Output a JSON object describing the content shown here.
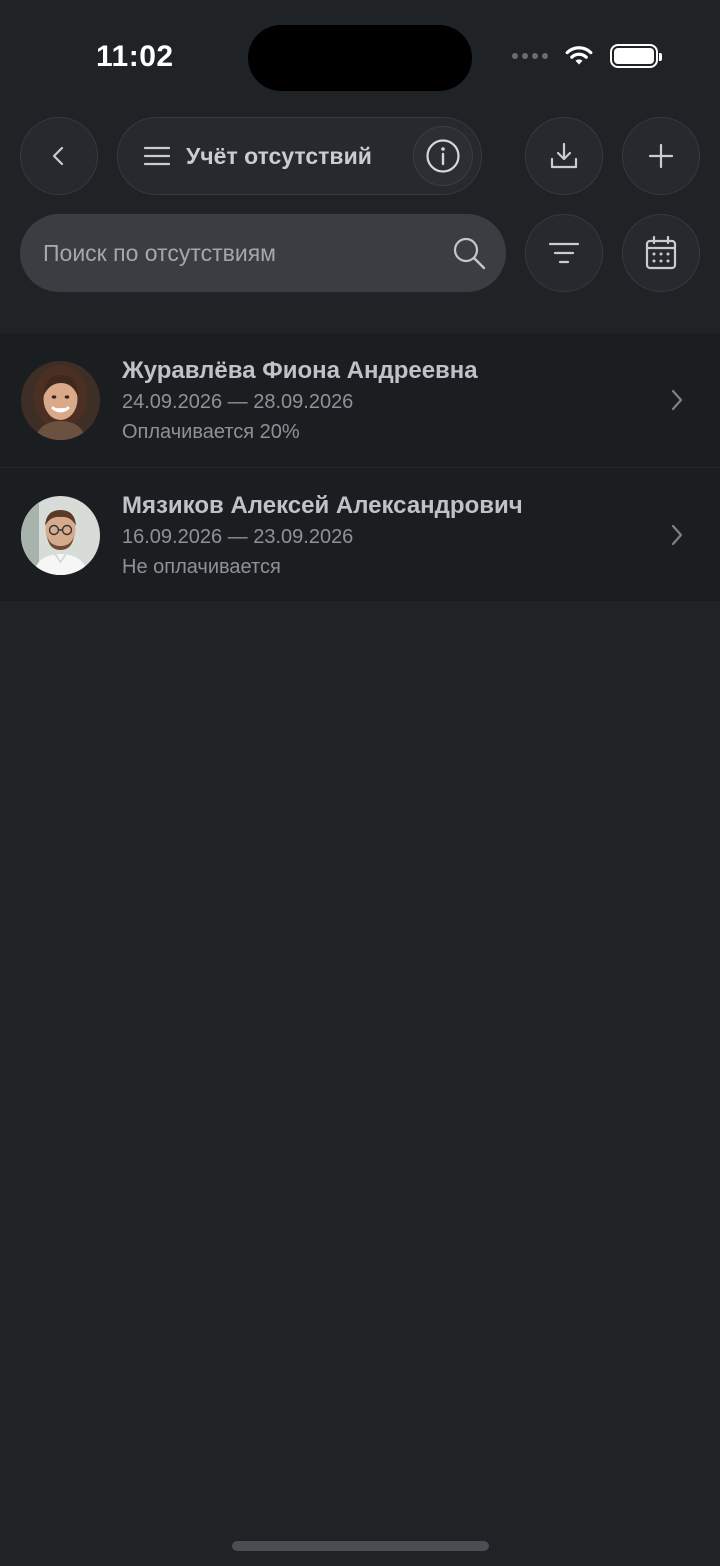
{
  "status_bar": {
    "time": "11:02"
  },
  "header": {
    "title": "Учёт отсутствий",
    "back_icon": "chevron-left-icon",
    "menu_icon": "hamburger-icon",
    "info_icon": "info-icon",
    "download_icon": "download-icon",
    "add_icon": "plus-icon"
  },
  "search": {
    "placeholder": "Поиск по отсутствиям",
    "filter_icon": "filter-icon",
    "calendar_icon": "calendar-icon"
  },
  "absences": [
    {
      "name": "Журавлёва Фиона Андреевна",
      "dates": "24.09.2026 — 28.09.2026",
      "payment": "Оплачивается 20%"
    },
    {
      "name": "Мязиков Алексей Александрович",
      "dates": "16.09.2026 — 23.09.2026",
      "payment": "Не оплачивается"
    }
  ],
  "colors": {
    "background": "#202326",
    "row_background": "#1b1e21",
    "button_background": "#26292d",
    "search_background": "#3a3d42",
    "text_primary": "#bfc2c6",
    "text_secondary": "#8e9297"
  }
}
